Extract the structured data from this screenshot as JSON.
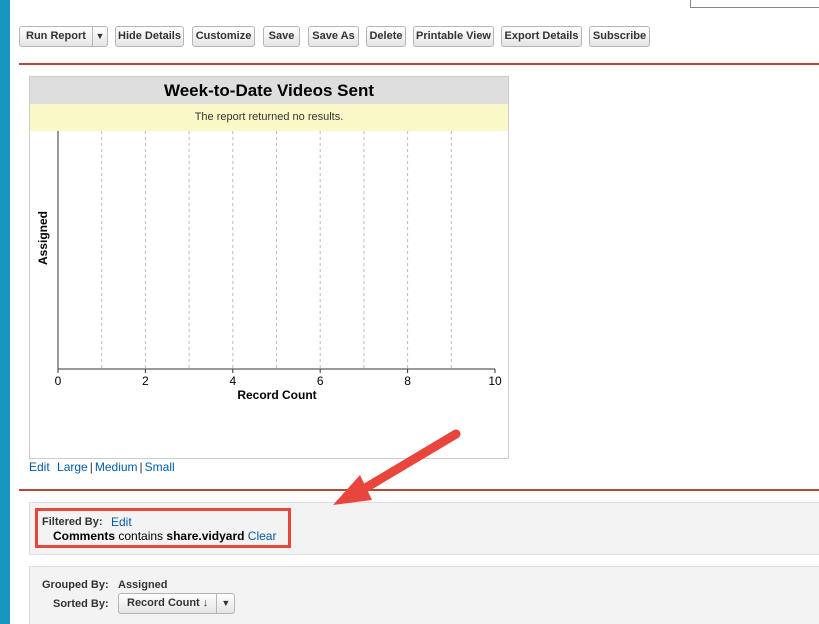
{
  "toolbar": {
    "run_report": "Run Report",
    "run_report_arrow": "▼",
    "hide_details": "Hide Details",
    "customize": "Customize",
    "save": "Save",
    "save_as": "Save As",
    "delete": "Delete",
    "printable_view": "Printable View",
    "export_details": "Export Details",
    "subscribe": "Subscribe"
  },
  "chart": {
    "message": "The report returned no results.",
    "size_links": {
      "edit": "Edit",
      "large": "Large",
      "medium": "Medium",
      "small": "Small",
      "separator": "|"
    }
  },
  "chart_data": {
    "type": "bar",
    "title": "Week-to-Date Videos Sent",
    "xlabel": "Record Count",
    "ylabel": "Assigned",
    "xlim": [
      0,
      10
    ],
    "x_ticks": [
      0,
      2,
      4,
      6,
      8,
      10
    ],
    "gridlines": [
      1,
      2,
      3,
      4,
      5,
      6,
      7,
      8,
      9
    ],
    "categories": [],
    "values": [],
    "grid": true
  },
  "filter": {
    "label": "Filtered By:",
    "edit": "Edit",
    "field": "Comments",
    "operator": "contains",
    "value": "share.vidyard",
    "clear": "Clear"
  },
  "grouping": {
    "grouped_label": "Grouped By:",
    "grouped_value": "Assigned",
    "sorted_label": "Sorted By:",
    "sorted_value": "Record Count ↓",
    "sorted_arrow": "▼"
  },
  "colors": {
    "annotation_arrow": "#e8453c",
    "link": "#015ba7",
    "section_separator": "#ad4a3a",
    "left_bar": "#1797c0"
  }
}
